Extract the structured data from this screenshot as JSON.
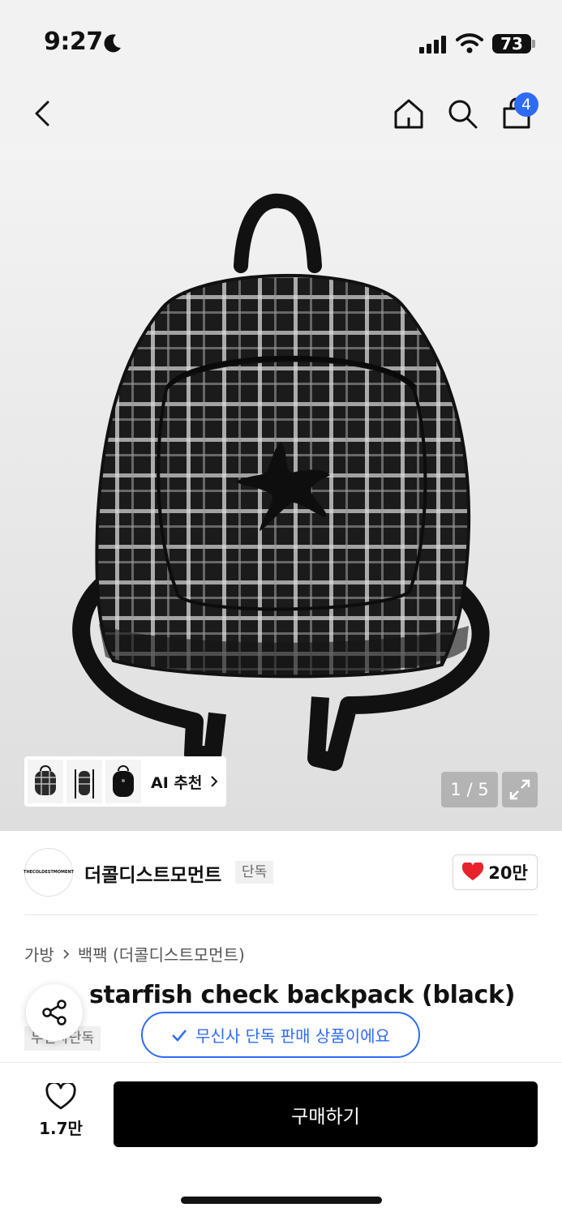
{
  "status_bar": {
    "time": "9:27",
    "battery": "73"
  },
  "header": {
    "cart_count": "4"
  },
  "gallery": {
    "ai_label": "AI 추천",
    "page_counter": "1 / 5"
  },
  "brand": {
    "name": "더콜디스트모먼트",
    "logo_text": "THECOLDESTMOMENT",
    "exclusive_chip": "단독",
    "likes": "20만"
  },
  "breadcrumb": {
    "category": "가방",
    "subcategory": "백팩 (더콜디스트모먼트)"
  },
  "product": {
    "title_visible": "starfish check backpack (black)",
    "tag": "무신사단독"
  },
  "toast": {
    "text": "무신사 단독 판매 상품이에요"
  },
  "bottom_bar": {
    "wish_count": "1.7만",
    "buy_label": "구매하기"
  },
  "colors": {
    "accent": "#2e6bf5",
    "heart": "#e8232b",
    "buy": "#000000"
  }
}
